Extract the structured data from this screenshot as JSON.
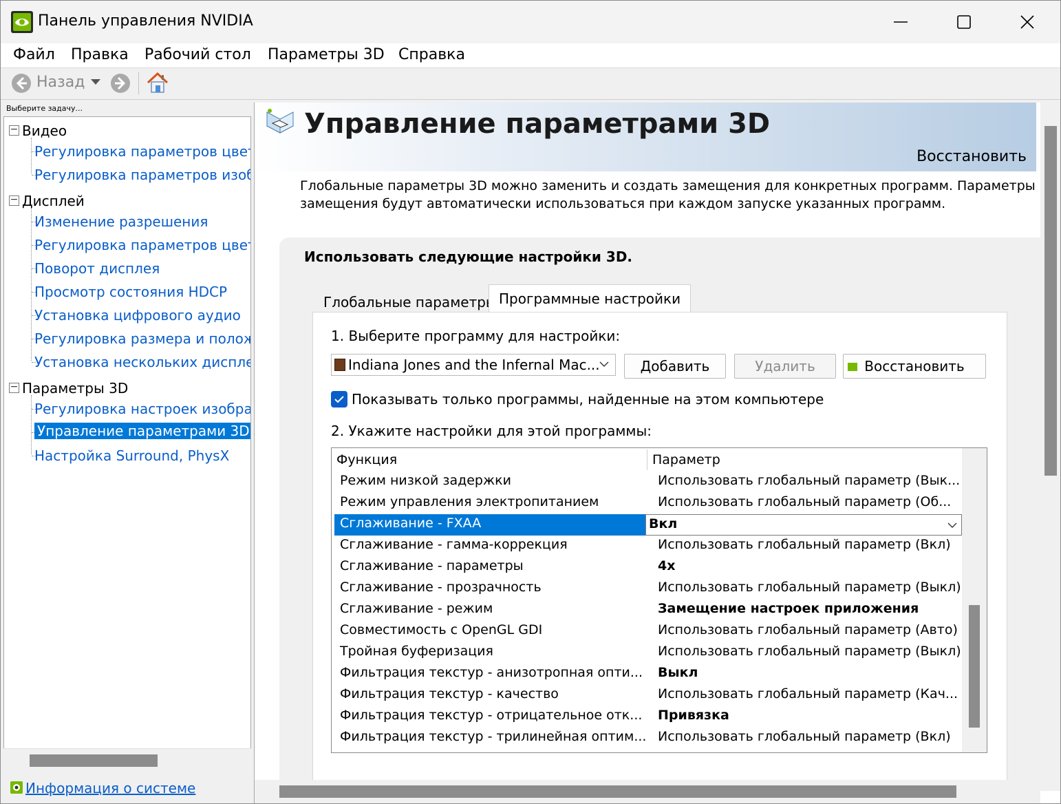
{
  "window": {
    "title": "Панель управления NVIDIA"
  },
  "menu": [
    "Файл",
    "Правка",
    "Рабочий стол",
    "Параметры 3D",
    "Справка"
  ],
  "toolbar": {
    "back_label": "Назад"
  },
  "sidebar": {
    "hint": "Выберите задачу...",
    "categories": [
      {
        "label": "Видео",
        "items": [
          "Регулировка параметров цвета для видео",
          "Регулировка параметров изображения для видео"
        ]
      },
      {
        "label": "Дисплей",
        "items": [
          "Изменение разрешения",
          "Регулировка параметров цвета рабочего стола",
          "Поворот дисплея",
          "Просмотр состояния HDCP",
          "Установка цифрового аудио",
          "Регулировка размера и положения рабочего стола",
          "Установка нескольких дисплеев"
        ]
      },
      {
        "label": "Параметры 3D",
        "items": [
          "Регулировка настроек изображения с просмотром",
          "Управление параметрами 3D",
          "Настройка Surround, PhysX"
        ]
      }
    ],
    "selected": "Управление параметрами 3D",
    "sysinfo": "Информация о системе"
  },
  "page": {
    "title": "Управление параметрами 3D",
    "restore": "Восстановить",
    "description": "Глобальные параметры 3D можно заменить и создать замещения для конкретных программ. Параметры замещения будут автоматически использоваться при каждом запуске указанных программ.",
    "group_title": "Использовать следующие настройки 3D.",
    "tabs": [
      "Глобальные параметры",
      "Программные настройки"
    ],
    "active_tab": "Программные настройки",
    "step1": "1. Выберите программу для настройки:",
    "program": "Indiana Jones and the Infernal Mac...",
    "add_button": "Добавить",
    "remove_button": "Удалить",
    "restore_button": "Восстановить",
    "show_only_checkbox": "Показывать только программы, найденные на этом компьютере",
    "show_only_checked": true,
    "step2": "2. Укажите настройки для этой программы:",
    "grid": {
      "col_function": "Функция",
      "col_parameter": "Параметр",
      "rows": [
        {
          "function": "Режим низкой задержки",
          "parameter": "Использовать глобальный параметр (Вык...",
          "bold": false
        },
        {
          "function": "Режим управления электропитанием",
          "parameter": "Использовать глобальный параметр (Об...",
          "bold": false
        },
        {
          "function": "Сглаживание - FXAA",
          "parameter": "Вкл",
          "bold": true,
          "selected": true
        },
        {
          "function": "Сглаживание - гамма-коррекция",
          "parameter": "Использовать глобальный параметр (Вкл)",
          "bold": false
        },
        {
          "function": "Сглаживание - параметры",
          "parameter": "4x",
          "bold": true
        },
        {
          "function": "Сглаживание - прозрачность",
          "parameter": "Использовать глобальный параметр (Выкл)",
          "bold": false
        },
        {
          "function": "Сглаживание - режим",
          "parameter": "Замещение настроек приложения",
          "bold": true
        },
        {
          "function": "Совместимость с OpenGL GDI",
          "parameter": "Использовать глобальный параметр (Авто)",
          "bold": false
        },
        {
          "function": "Тройная буферизация",
          "parameter": "Использовать глобальный параметр (Выкл)",
          "bold": false
        },
        {
          "function": "Фильтрация текстур - анизотропная опти...",
          "parameter": "Выкл",
          "bold": true
        },
        {
          "function": "Фильтрация текстур - качество",
          "parameter": "Использовать глобальный параметр (Кач...",
          "bold": false
        },
        {
          "function": "Фильтрация текстур - отрицательное отк...",
          "parameter": "Привязка",
          "bold": true
        },
        {
          "function": "Фильтрация текстур - трилинейная оптим...",
          "parameter": "Использовать глобальный параметр (Вкл)",
          "bold": false
        }
      ]
    }
  },
  "colors": {
    "accent": "#0078d7",
    "link": "#0a5ec9",
    "nvidia_green": "#76b900"
  }
}
